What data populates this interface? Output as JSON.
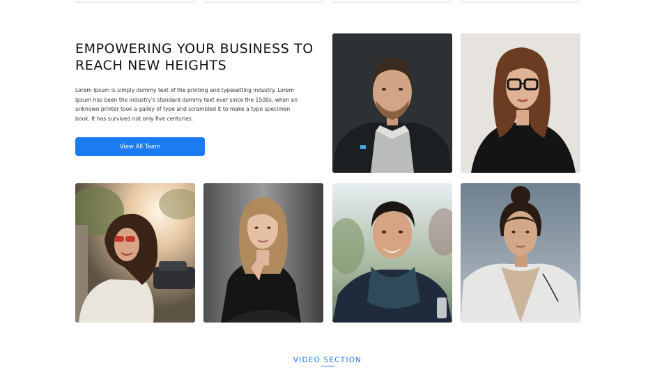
{
  "hero": {
    "title": "EMPOWERING YOUR BUSINESS TO REACH NEW HEIGHTS",
    "description": "Lorem Ipsum is simply dummy text of the printing and typesetting industry. Lorem Ipsum has been the industry's standard dummy text ever since the 1500s, when an unknown printer took a galley of type and scrambled it to make a type specimen book. It has survived not only five centuries.",
    "cta_label": "View All Team"
  },
  "team": [
    {
      "photo": "smiling-bearded-man-photo"
    },
    {
      "photo": "woman-with-glasses-photo"
    },
    {
      "photo": "woman-sunglasses-sunlight-photo"
    },
    {
      "photo": "woman-black-sweater-photo"
    },
    {
      "photo": "smiling-man-scarf-photo"
    },
    {
      "photo": "woman-white-jacket-photo"
    }
  ],
  "next_section": {
    "label": "VIDEO SECTION"
  },
  "colors": {
    "accent": "#1b7cf2"
  }
}
